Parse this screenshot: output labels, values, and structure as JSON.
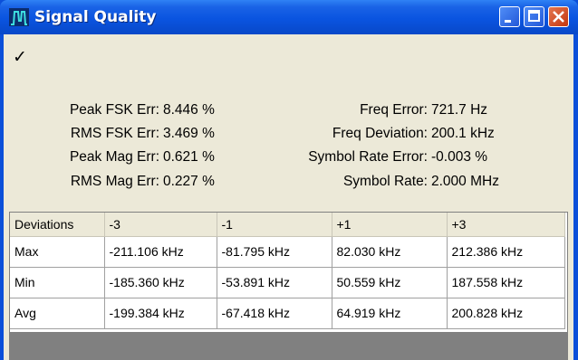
{
  "window": {
    "title": "Signal Quality",
    "status_icon": "checkmark-icon"
  },
  "stats_left": [
    {
      "label": "Peak FSK Err:",
      "value": "8.446 %"
    },
    {
      "label": "RMS FSK Err:",
      "value": "3.469 %"
    },
    {
      "label": "Peak Mag Err:",
      "value": "0.621 %"
    },
    {
      "label": "RMS Mag Err:",
      "value": "0.227 %"
    }
  ],
  "stats_right": [
    {
      "label": "Freq Error:",
      "value": "721.7 Hz"
    },
    {
      "label": "Freq Deviation:",
      "value": "200.1 kHz"
    },
    {
      "label": "Symbol Rate Error:",
      "value": "-0.003 %"
    },
    {
      "label": "Symbol Rate:",
      "value": "2.000 MHz"
    }
  ],
  "table": {
    "headers": [
      "Deviations",
      "-3",
      "-1",
      "+1",
      "+3"
    ],
    "rows": [
      [
        "Max",
        "-211.106 kHz",
        "-81.795 kHz",
        "82.030 kHz",
        "212.386 kHz"
      ],
      [
        "Min",
        "-185.360 kHz",
        "-53.891 kHz",
        "50.559 kHz",
        "187.558 kHz"
      ],
      [
        "Avg",
        "-199.384 kHz",
        "-67.418 kHz",
        "64.919 kHz",
        "200.828 kHz"
      ]
    ]
  },
  "colors": {
    "titlebar": "#0a54e0",
    "client_bg": "#ece9d8",
    "close_button": "#c3360f"
  }
}
